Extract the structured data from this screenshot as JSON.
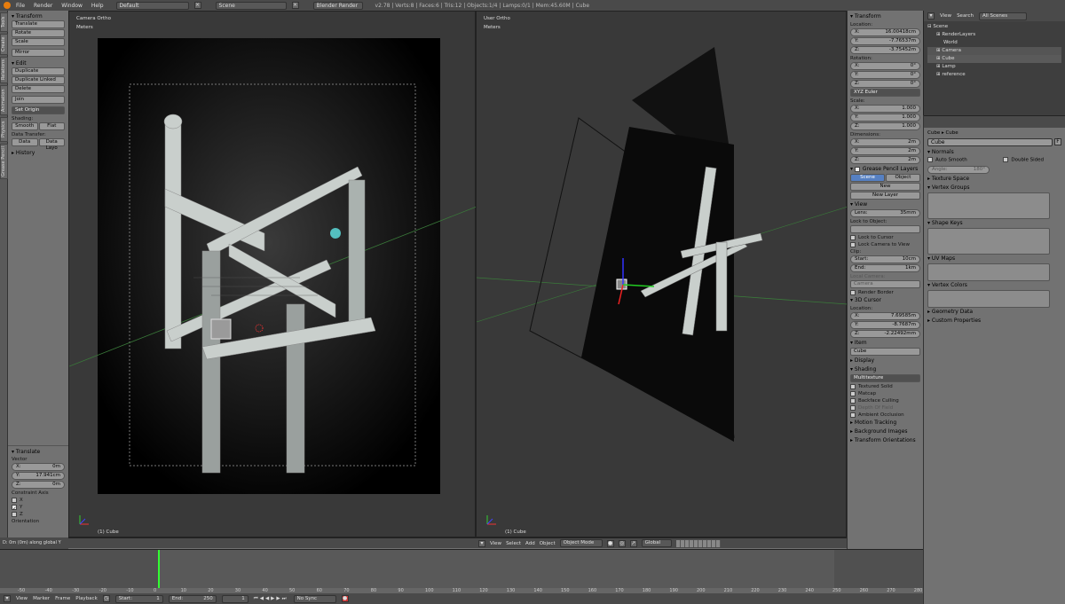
{
  "topbar": {
    "menus": [
      "File",
      "Render",
      "Window",
      "Help"
    ],
    "layout": "Default",
    "scene": "Scene",
    "engine": "Blender Render",
    "stats": "v2.78 | Verts:8 | Faces:6 | Tris:12 | Objects:1/4 | Lamps:0/1 | Mem:45.60M | Cube"
  },
  "shelf_tabs": [
    "Tools",
    "Create",
    "Relations",
    "Animation",
    "Physics",
    "Grease Pencil"
  ],
  "tools": {
    "transform_header": "Transform",
    "transform": [
      "Translate",
      "Rotate",
      "Scale"
    ],
    "mirror": "Mirror",
    "edit_header": "Edit",
    "edit": [
      "Duplicate",
      "Duplicate Linked",
      "Delete"
    ],
    "join": "Join",
    "set_origin": "Set Origin",
    "shading_label": "Shading:",
    "smooth": "Smooth",
    "flat": "Flat",
    "data_transfer_label": "Data Transfer:",
    "data": "Data",
    "data_layo": "Data Layo",
    "history": "History"
  },
  "operator": {
    "header": "Translate",
    "vector_label": "Vector",
    "x": "X:",
    "x_val": "0m",
    "y": "Y:",
    "y_val": "17.941cm",
    "z": "Z:",
    "z_val": "0m",
    "constraint_label": "Constraint Axis",
    "axes": [
      "X",
      "Y",
      "Z"
    ],
    "orientation": "Orientation",
    "status": "D: 0m (0m) along global Y"
  },
  "left_view": {
    "name": "Camera Ortho",
    "units": "Meters",
    "object": "(1) Cube"
  },
  "right_view": {
    "name": "User Ortho",
    "units": "Meters",
    "object": "(1) Cube"
  },
  "vp_header": {
    "menus": [
      "View",
      "Select",
      "Add",
      "Object"
    ],
    "mode": "Object Mode",
    "orientation": "Global"
  },
  "npanel": {
    "transform": "Transform",
    "location": "Location:",
    "loc": [
      [
        "X:",
        "16.00418cm"
      ],
      [
        "Y:",
        "-7.76537m"
      ],
      [
        "Z:",
        "-3.75452m"
      ]
    ],
    "rotation": "Rotation:",
    "rot": [
      [
        "X:",
        "0°"
      ],
      [
        "Y:",
        "0°"
      ],
      [
        "Z:",
        "0°"
      ]
    ],
    "euler": "XYZ Euler",
    "scale": "Scale:",
    "scl": [
      [
        "X:",
        "1.000"
      ],
      [
        "Y:",
        "1.000"
      ],
      [
        "Z:",
        "1.000"
      ]
    ],
    "dimensions": "Dimensions:",
    "dim": [
      [
        "X:",
        "2m"
      ],
      [
        "Y:",
        "2m"
      ],
      [
        "Z:",
        "2m"
      ]
    ],
    "gp_layers": "Grease Pencil Layers",
    "scene": "Scene",
    "object": "Object",
    "new": "New",
    "new_layer": "New Layer",
    "view": "View",
    "lens": "Lens:",
    "lens_val": "35mm",
    "lock_object": "Lock to Object:",
    "lock_cursor": "Lock to Cursor",
    "lock_camera": "Lock Camera to View",
    "clip": "Clip:",
    "start": "Start:",
    "start_val": "10cm",
    "end": "End:",
    "end_val": "1km",
    "local_camera": "Local Camera:",
    "camera": "Camera",
    "render_border": "Render Border",
    "cursor": "3D Cursor",
    "cursor_loc": "Location:",
    "cur": [
      [
        "X:",
        "7.69585m"
      ],
      [
        "Y:",
        "-8.7687m"
      ],
      [
        "Z:",
        "-2.22492mm"
      ]
    ],
    "item": "Item",
    "item_name": "Cube",
    "display": "Display",
    "shading": "Shading",
    "multitexture": "Multitexture",
    "shade_opts": [
      "Textured Solid",
      "Matcap",
      "Backface Culling",
      "Depth Of Field",
      "Ambient Occlusion"
    ],
    "motion": "Motion Tracking",
    "bg_images": "Background Images",
    "orientations": "Transform Orientations"
  },
  "outliner": {
    "menus": [
      "View",
      "Search"
    ],
    "filter": "All Scenes",
    "items": [
      "Scene",
      "RenderLayers",
      "World",
      "Camera",
      "Cube",
      "Lamp",
      "reference"
    ]
  },
  "properties": {
    "obj1": "Cube",
    "obj2": "Cube",
    "mesh": "Cube",
    "mesh_f": "F",
    "normals": "Normals",
    "auto_smooth": "Auto Smooth",
    "double_sided": "Double Sided",
    "angle": "Angle:",
    "angle_val": "180°",
    "panels": [
      "Texture Space",
      "Vertex Groups",
      "Shape Keys",
      "UV Maps",
      "Vertex Colors",
      "Geometry Data",
      "Custom Properties"
    ]
  },
  "timeline": {
    "ticks": [
      "-50",
      "-40",
      "-30",
      "-20",
      "-10",
      "0",
      "10",
      "20",
      "30",
      "40",
      "50",
      "60",
      "70",
      "80",
      "90",
      "100",
      "110",
      "120",
      "130",
      "140",
      "150",
      "160",
      "170",
      "180",
      "190",
      "200",
      "210",
      "220",
      "230",
      "240",
      "250",
      "260",
      "270",
      "280"
    ],
    "menus": [
      "View",
      "Marker",
      "Frame",
      "Playback"
    ],
    "start": "Start:",
    "start_val": "1",
    "end": "End:",
    "end_val": "250",
    "frame": "1",
    "sync": "No Sync"
  }
}
